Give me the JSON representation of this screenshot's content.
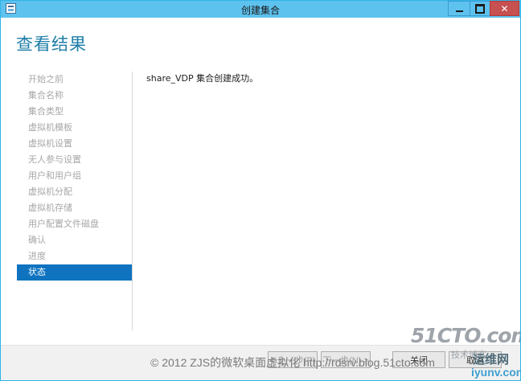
{
  "window": {
    "title": "创建集合",
    "controls": {
      "minimize": "minimize",
      "maximize": "maximize",
      "close": "✕"
    }
  },
  "page": {
    "heading": "查看结果",
    "message": "share_VDP 集合创建成功。"
  },
  "nav": {
    "items": [
      {
        "label": "开始之前",
        "active": false
      },
      {
        "label": "集合名称",
        "active": false
      },
      {
        "label": "集合类型",
        "active": false
      },
      {
        "label": "虚拟机模板",
        "active": false
      },
      {
        "label": "虚拟机设置",
        "active": false
      },
      {
        "label": "无人参与设置",
        "active": false
      },
      {
        "label": "用户和用户组",
        "active": false
      },
      {
        "label": "虚拟机分配",
        "active": false
      },
      {
        "label": "虚拟机存储",
        "active": false
      },
      {
        "label": "用户配置文件磁盘",
        "active": false
      },
      {
        "label": "确认",
        "active": false
      },
      {
        "label": "进度",
        "active": false
      },
      {
        "label": "状态",
        "active": true
      }
    ]
  },
  "footer": {
    "prev": "< 上一步(P)",
    "next": "下一步(N) >",
    "create": "关闭",
    "cancel": "取消"
  },
  "watermark": {
    "copyright": "© 2012 ZJS的微软桌面虚拟化 http://rdsrv.blog.51cto.com",
    "brand": "51CTO.com",
    "blog": "技术博客",
    "yunwei": "运维网",
    "site": "iyunv.com"
  },
  "colors": {
    "titlebar": "#5ec2ee",
    "heading": "#1f7ea8",
    "active_nav": "#0f73c0",
    "close_button": "#c75050"
  }
}
